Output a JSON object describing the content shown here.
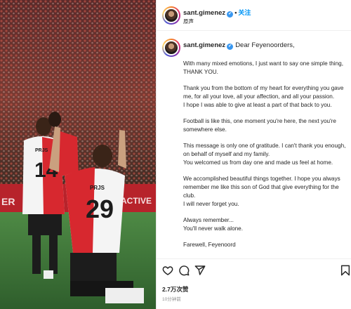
{
  "header": {
    "username": "sant.gimenez",
    "verified_mark": "✔",
    "separator": "•",
    "follow_label": "关注",
    "audio_label": "原声",
    "more_icon": "more-horizontal-icon"
  },
  "media": {
    "jersey_left": "14",
    "jersey_right": "29",
    "jersey_text": "PRJS"
  },
  "caption": {
    "username": "sant.gimenez",
    "greeting": "Dear Feyenoorders,",
    "paragraphs": [
      [
        "With many mixed emotions, I just want to say one simple thing,",
        "THANK YOU."
      ],
      [
        "Thank you from the bottom of my heart for everything you gave",
        "me, for all your love, all your affection, and all your passion.",
        "I hope I was able to give at least a part of that back to you."
      ],
      [
        "Football is like this, one moment you're here, the next you're",
        "somewhere else."
      ],
      [
        "This message is only one of gratitude. I can't thank you enough,",
        "on behalf of myself and my family.",
        "You welcomed us from day one and made us feel at home."
      ],
      [
        "We accomplished beautiful things together. I hope you always",
        "remember me like this son of God that give everything for the",
        "club.",
        "I will never forget you."
      ],
      [
        "Always remember...",
        "You'll never walk alone."
      ],
      [
        "Farewell, Feyenoord"
      ]
    ]
  },
  "actions": {
    "like_icon": "heart-icon",
    "comment_icon": "comment-icon",
    "share_icon": "send-icon",
    "save_icon": "bookmark-icon",
    "likes_text": "2.7万次赞",
    "time_text": "10分钟前"
  },
  "colors": {
    "link_blue": "#0095f6",
    "verified_blue": "#3897f0",
    "jersey_red": "#d7282f",
    "jersey_white": "#f4f4f4",
    "pitch_green": "#3f7a3a"
  }
}
